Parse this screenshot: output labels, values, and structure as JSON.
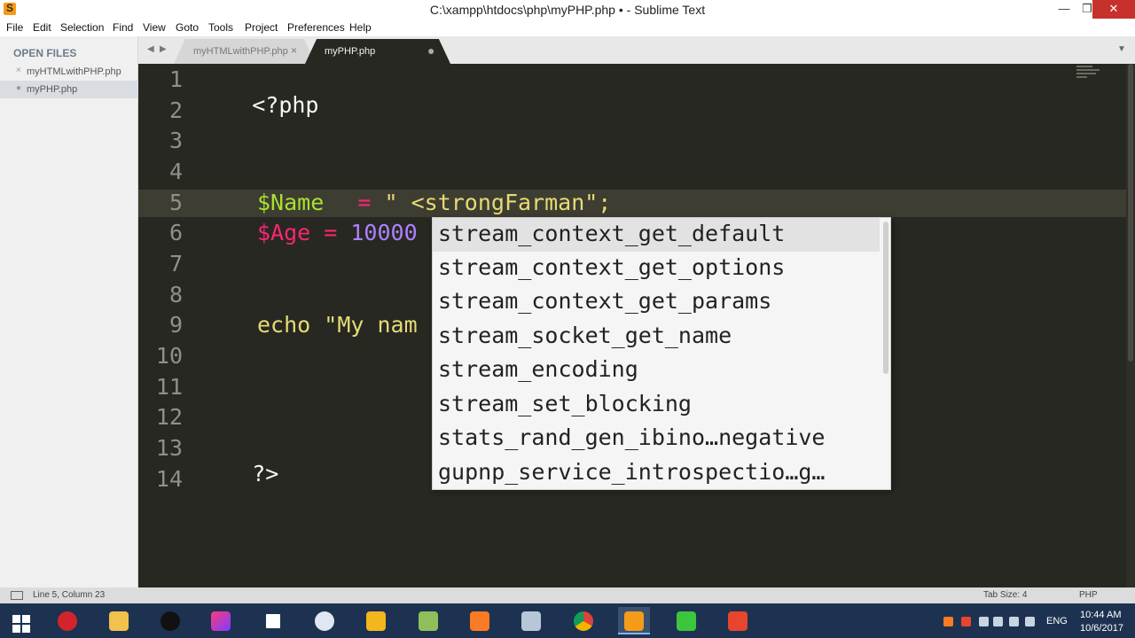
{
  "window": {
    "title": "C:\\xampp\\htdocs\\php\\myPHP.php • - Sublime Text",
    "min_label": "—",
    "max_label": "❐",
    "close_label": "✕"
  },
  "menu": [
    "File",
    "Edit",
    "Selection",
    "Find",
    "View",
    "Goto",
    "Tools",
    "Project",
    "Preferences",
    "Help"
  ],
  "sidebar": {
    "header": "OPEN FILES",
    "files": [
      {
        "mark": "×",
        "name": "myHTMLwithPHP.php"
      },
      {
        "mark": "●",
        "name": "myPHP.php"
      }
    ]
  },
  "tabs": [
    {
      "label": "myHTMLwithPHP.php",
      "close": "×"
    },
    {
      "label": "myPHP.php",
      "close": "●"
    }
  ],
  "tab_nav": {
    "left": "◀",
    "right": "▶",
    "menu": "▼"
  },
  "editor": {
    "line_numbers": [
      "1",
      "2",
      "3",
      "4",
      "5",
      "6",
      "7",
      "8",
      "9",
      "10",
      "11",
      "12",
      "13",
      "14"
    ],
    "code": {
      "l1": "<?php",
      "l5_var": "$Name",
      "l5_sp": "  ",
      "l5_op": "=",
      "l5_str": " \" <strongFarman\";",
      "l6_var": "$Age",
      "l6_op": " = ",
      "l6_num": "10000",
      "l9_kw": "echo",
      "l9_str": " \"My nam",
      "l13": "?>"
    }
  },
  "autocomplete": {
    "items": [
      "stream_context_get_default",
      "stream_context_get_options",
      "stream_context_get_params",
      "stream_socket_get_name",
      "stream_encoding",
      "stream_set_blocking",
      "stats_rand_gen_ibino…negative",
      "gupnp_service_introspectio…g…"
    ],
    "selected_index": 0
  },
  "status": {
    "position": "Line 5, Column 23",
    "tab_size": "Tab Size: 4",
    "syntax": "PHP"
  },
  "taskbar": {
    "apps": [
      "start",
      "opera",
      "file-explorer",
      "pen-tool",
      "intellij",
      "brackets",
      "paint",
      "outlook",
      "notepadpp",
      "xampp",
      "network",
      "chrome",
      "sublime",
      "camtasia-green",
      "camtasia-red"
    ],
    "tray": {
      "lang": "ENG",
      "time": "10:44 AM",
      "date": "10/6/2017"
    }
  }
}
